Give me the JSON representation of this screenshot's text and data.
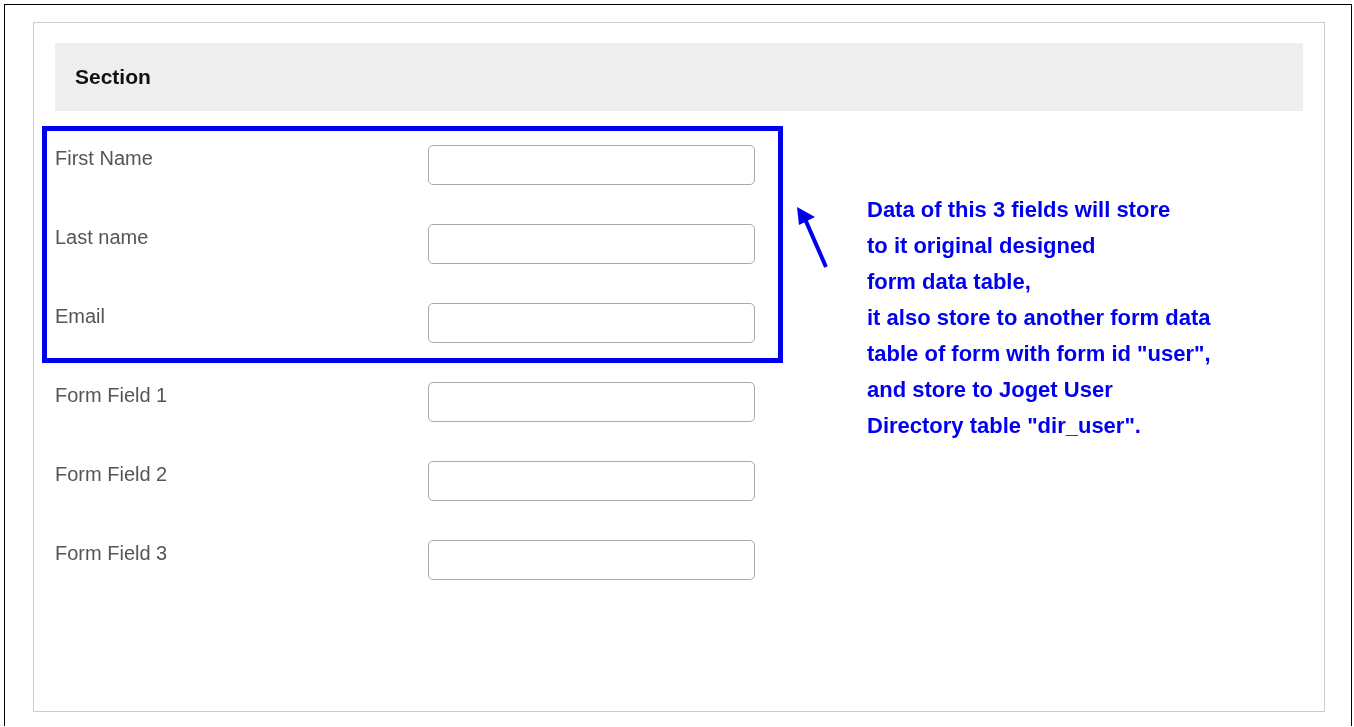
{
  "section": {
    "title": "Section"
  },
  "highlighted_fields": [
    {
      "label": "First Name"
    },
    {
      "label": "Last name"
    },
    {
      "label": "Email"
    }
  ],
  "other_fields": [
    {
      "label": "Form Field 1"
    },
    {
      "label": "Form Field 2"
    },
    {
      "label": "Form Field 3"
    }
  ],
  "annotation": {
    "lines": [
      "Data of this 3 fields will store",
      "to it original designed",
      "form data table,",
      "it also store to another form data",
      "table of form with form id \"user\",",
      "and store to Joget User",
      "Directory table \"dir_user\"."
    ]
  }
}
